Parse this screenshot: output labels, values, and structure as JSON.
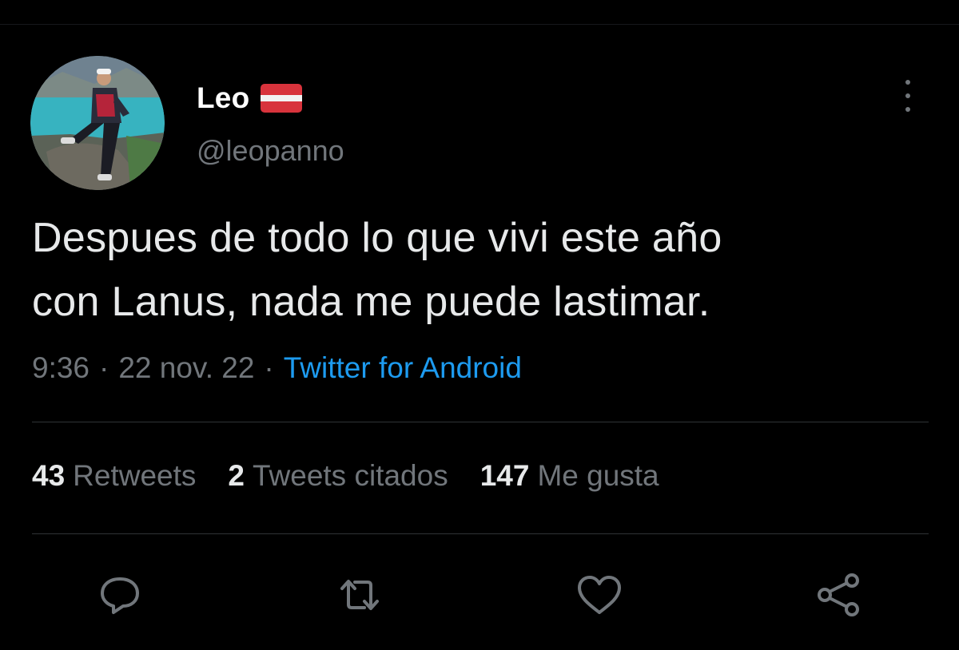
{
  "tweet": {
    "author": {
      "display_name": "Leo",
      "handle": "@leopanno",
      "flag_icon": "latvia-flag-icon",
      "avatar_icon": "profile-photo"
    },
    "text_lines": [
      "Despues de todo lo que vivi este año",
      "con Lanus, nada me puede lastimar."
    ],
    "time": "9:36",
    "date": "22 nov. 22",
    "separator": "·",
    "source": "Twitter for Android",
    "stats": {
      "retweets_count": "43",
      "retweets_label": "Retweets",
      "quotes_count": "2",
      "quotes_label": "Tweets citados",
      "likes_count": "147",
      "likes_label": "Me gusta"
    },
    "actions": [
      "reply-icon",
      "retweet-icon",
      "like-icon",
      "share-icon"
    ]
  },
  "colors": {
    "background": "#000000",
    "primary_text": "#e7e9ea",
    "secondary_text": "#71767b",
    "link": "#1d9bf0",
    "divider": "#2f3336",
    "flag_red": "#d8333c",
    "flag_white": "#f2f2f2"
  }
}
